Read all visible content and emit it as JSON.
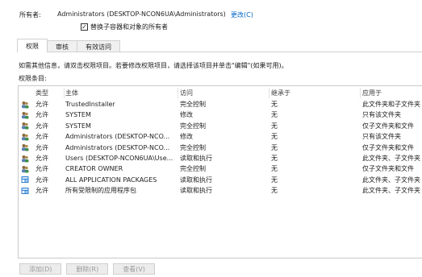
{
  "owner": {
    "label": "所有者:",
    "value": "Administrators (DESKTOP-NCON6UA\\Administrators)",
    "change_link": "更改(C)"
  },
  "replace_owner_checkbox": {
    "label": "替换子容器和对象的所有者",
    "checked": true
  },
  "tabs": [
    {
      "label": "权限",
      "active": true
    },
    {
      "label": "审核",
      "active": false
    },
    {
      "label": "有效访问",
      "active": false
    }
  ],
  "hint": "如需其他信息，请双击权限项目。若要修改权限项目，请选择该项目并单击\"编辑\"(如果可用)。",
  "entries_label": "权限条目:",
  "table": {
    "columns": [
      "类型",
      "主体",
      "访问",
      "继承于",
      "应用于"
    ],
    "rows": [
      {
        "icon": "users-icon",
        "type": "允许",
        "principal": "TrustedInstaller",
        "access": "完全控制",
        "inherited": "无",
        "applies": "此文件夹和子文件夹"
      },
      {
        "icon": "users-icon",
        "type": "允许",
        "principal": "SYSTEM",
        "access": "修改",
        "inherited": "无",
        "applies": "只有该文件夹"
      },
      {
        "icon": "users-icon",
        "type": "允许",
        "principal": "SYSTEM",
        "access": "完全控制",
        "inherited": "无",
        "applies": "仅子文件夹和文件"
      },
      {
        "icon": "users-icon",
        "type": "允许",
        "principal": "Administrators (DESKTOP-NCO...",
        "access": "修改",
        "inherited": "无",
        "applies": "只有该文件夹"
      },
      {
        "icon": "users-icon",
        "type": "允许",
        "principal": "Administrators (DESKTOP-NCO...",
        "access": "完全控制",
        "inherited": "无",
        "applies": "仅子文件夹和文件"
      },
      {
        "icon": "users-icon",
        "type": "允许",
        "principal": "Users (DESKTOP-NCON6UA\\Use...",
        "access": "读取和执行",
        "inherited": "无",
        "applies": "此文件夹、子文件夹"
      },
      {
        "icon": "users-icon",
        "type": "允许",
        "principal": "CREATOR OWNER",
        "access": "完全控制",
        "inherited": "无",
        "applies": "仅子文件夹和文件"
      },
      {
        "icon": "package-icon",
        "type": "允许",
        "principal": "ALL APPLICATION PACKAGES",
        "access": "读取和执行",
        "inherited": "无",
        "applies": "此文件夹、子文件夹"
      },
      {
        "icon": "package-icon",
        "type": "允许",
        "principal": "所有受限制的应用程序包",
        "access": "读取和执行",
        "inherited": "无",
        "applies": "此文件夹、子文件夹"
      }
    ]
  },
  "buttons": {
    "add": "添加(D)",
    "remove": "删除(R)",
    "view": "查看(V)"
  }
}
